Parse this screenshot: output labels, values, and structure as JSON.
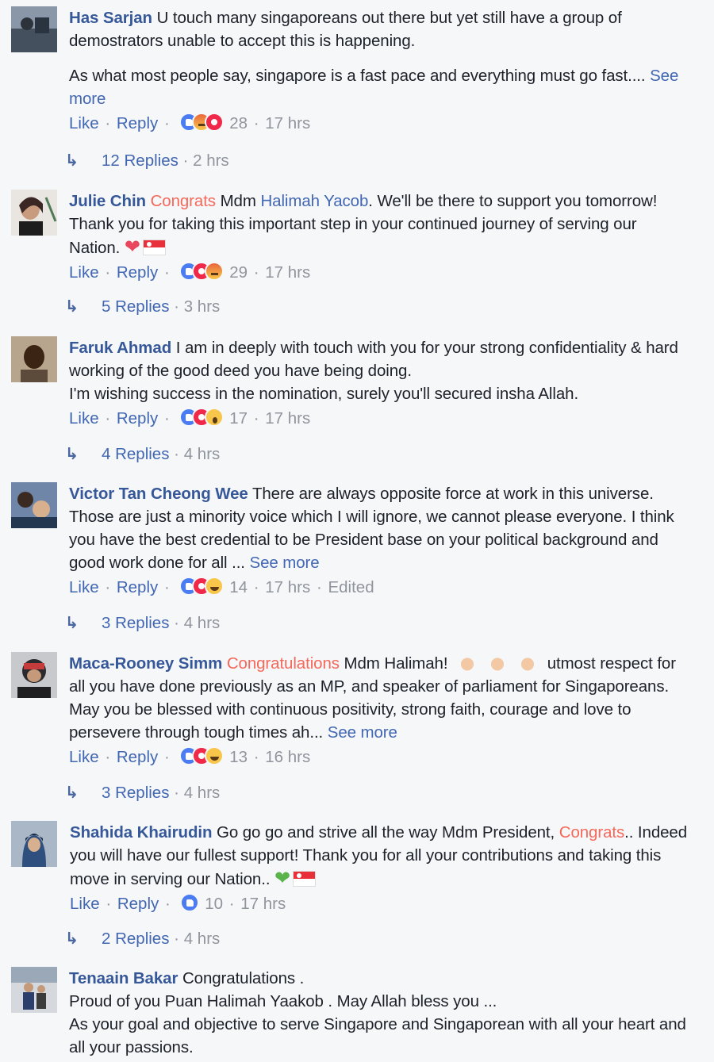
{
  "labels": {
    "like": "Like",
    "reply": "Reply",
    "dot": "·"
  },
  "comments": [
    {
      "author": "Has Sarjan",
      "text": "U touch many singaporeans out there but yet still have a group of demostrators unable to accept this is happening.",
      "text2": "As what most people say, singapore is a fast pace and everything must go fast....",
      "see_more": "See more",
      "reaction_count": "28",
      "time": "17 hrs",
      "reactions": [
        "like-icon",
        "angry-icon",
        "love-icon"
      ],
      "replies": "12 Replies",
      "replies_time": "2 hrs"
    },
    {
      "author": "Julie Chin",
      "tag": "Congrats",
      "text_a": "Mdm",
      "mention": "Halimah Yacob",
      "text_b": ". We'll be there to support you tomorrow! Thank you for taking this important step in your continued journey of serving our Nation.",
      "reaction_count": "29",
      "time": "17 hrs",
      "reactions": [
        "like-icon",
        "love-icon",
        "angry-icon"
      ],
      "replies": "5 Replies",
      "replies_time": "3 hrs"
    },
    {
      "author": "Faruk Ahmad",
      "text": "I am in deeply with touch with you for your strong confidentiality & hard working of the good deed you have being doing.",
      "text2": "I'm wishing success in the nomination, surely you'll secured insha Allah.",
      "reaction_count": "17",
      "time": "17 hrs",
      "reactions": [
        "like-icon",
        "love-icon",
        "wow-icon"
      ],
      "replies": "4 Replies",
      "replies_time": "4 hrs"
    },
    {
      "author": "Victor Tan Cheong Wee",
      "text": "There are always opposite force at work in this universe. Those are just a minority voice which I will ignore, we cannot please everyone. I think you have the best credential to be President base on your political background and good work done for all ...",
      "see_more": "See more",
      "reaction_count": "14",
      "time": "17 hrs",
      "edited": "Edited",
      "reactions": [
        "like-icon",
        "love-icon",
        "haha-icon"
      ],
      "replies": "3 Replies",
      "replies_time": "4 hrs"
    },
    {
      "author": "Maca-Rooney Simm",
      "tag": "Congratulations",
      "text_a": "Mdm Halimah!",
      "text_b": "utmost respect for all you have done previously as an MP, and speaker of parliament for Singaporeans. May you be blessed with continuous positivity, strong faith, courage and love to persevere through tough times ah...",
      "see_more": "See more",
      "reaction_count": "13",
      "time": "16 hrs",
      "reactions": [
        "like-icon",
        "love-icon",
        "haha-icon"
      ],
      "replies": "3 Replies",
      "replies_time": "4 hrs"
    },
    {
      "author": "Shahida Khairudin",
      "text_a": "Go go go and strive all the way Mdm President,",
      "tag": "Congrats",
      "text_b": ".. Indeed you will have our fullest support! Thank you for all your contributions and taking this move in serving our Nation..",
      "reaction_count": "10",
      "time": "17 hrs",
      "reactions": [
        "like-icon"
      ],
      "replies": "2 Replies",
      "replies_time": "4 hrs"
    },
    {
      "author": "Tenaain Bakar",
      "text": "Congratulations .",
      "text2": "Proud of you Puan Halimah Yaakob . May Allah bless you ...",
      "text3": "As your goal and objective to serve Singapore and Singaporean with all your heart and all your passions."
    }
  ]
}
